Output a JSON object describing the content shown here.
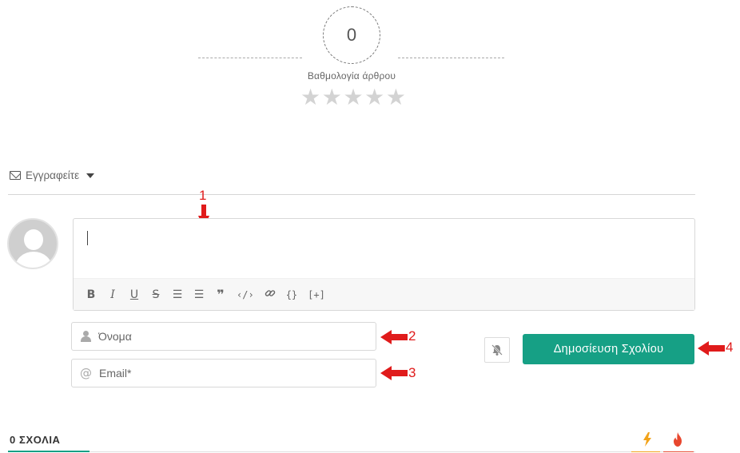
{
  "rating": {
    "score": "0",
    "label": "Βαθμολογία άρθρου",
    "stars_total": 5,
    "stars_filled": 0
  },
  "subscribe": {
    "label": "Εγγραφείτε",
    "icon": "envelope-icon"
  },
  "annotations": [
    "1",
    "2",
    "3",
    "4"
  ],
  "editor": {
    "value": "",
    "toolbar": {
      "bold": "B",
      "italic": "I",
      "underline": "U",
      "strike": "S",
      "ordered_list": "☰",
      "unordered_list": "☰",
      "quote": "❞",
      "code": "‹/›",
      "link": "🔗",
      "code_block": "{}",
      "spoiler": "[+]"
    }
  },
  "form": {
    "name_placeholder": "Όνομα",
    "email_placeholder": "Email*",
    "submit_label": "Δημοσίευση Σχολίου"
  },
  "comments": {
    "count_label": "0 ΣΧΟΛΙΑ"
  },
  "colors": {
    "accent": "#16a085",
    "annotation": "#e01b1b",
    "bolt": "#f2a31a",
    "fire": "#e8472e"
  }
}
